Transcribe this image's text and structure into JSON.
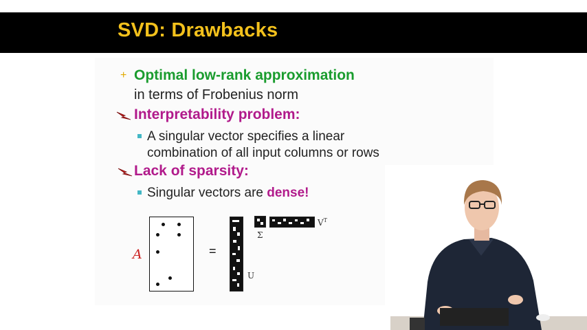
{
  "slide": {
    "title": "SVD: Drawbacks",
    "bullets": [
      {
        "marker": "+",
        "line1": "Optimal low-rank approximation",
        "line2": "in terms of Frobenius norm"
      },
      {
        "marker": "lightning-bolt",
        "line1": "Interpretability problem:"
      },
      {
        "sub": "A singular vector specifies a linear",
        "sub2": "combination of all input columns or rows"
      },
      {
        "marker": "lightning-bolt",
        "line1": "Lack of sparsity:"
      },
      {
        "sub": "Singular vectors are ",
        "sub_em": "dense!"
      }
    ],
    "diagram": {
      "handwritten_label": "A",
      "equals": "=",
      "u_label": "U",
      "sigma_label": "Σ",
      "vt_label": "V",
      "vt_sup": "T"
    }
  },
  "colors": {
    "title": "#f3c11c",
    "green": "#1a9c2e",
    "magenta": "#b11a8b",
    "bullet": "#43b7c5"
  }
}
